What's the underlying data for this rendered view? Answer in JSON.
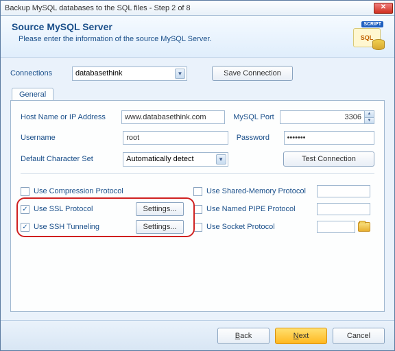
{
  "window": {
    "title": "Backup MySQL databases to the SQL files - Step 2 of 8"
  },
  "header": {
    "title": "Source MySQL Server",
    "subtitle": "Please enter the information of the source MySQL Server.",
    "badge": "SCRIPT",
    "icon_text": "SQL"
  },
  "connections": {
    "label": "Connections",
    "selected": "databasethink",
    "save_btn": "Save Connection"
  },
  "tab": {
    "general": "General"
  },
  "form": {
    "host_label": "Host Name or IP Address",
    "host_value": "www.databasethink.com",
    "port_label": "MySQL Port",
    "port_value": "3306",
    "user_label": "Username",
    "user_value": "root",
    "pass_label": "Password",
    "pass_value": "•••••••",
    "charset_label": "Default Character Set",
    "charset_value": "Automatically detect",
    "test_btn": "Test Connection"
  },
  "protocols": {
    "compression": "Use Compression Protocol",
    "ssl": "Use SSL Protocol",
    "ssh": "Use SSH Tunneling",
    "shared_mem": "Use Shared-Memory Protocol",
    "named_pipe": "Use Named PIPE Protocol",
    "socket": "Use Socket Protocol",
    "settings_btn": "Settings...",
    "ssl_checked": true,
    "ssh_checked": true,
    "compression_checked": false,
    "shared_mem_checked": false,
    "named_pipe_checked": false,
    "socket_checked": false
  },
  "footer": {
    "back": "Back",
    "next": "Next",
    "cancel": "Cancel"
  }
}
